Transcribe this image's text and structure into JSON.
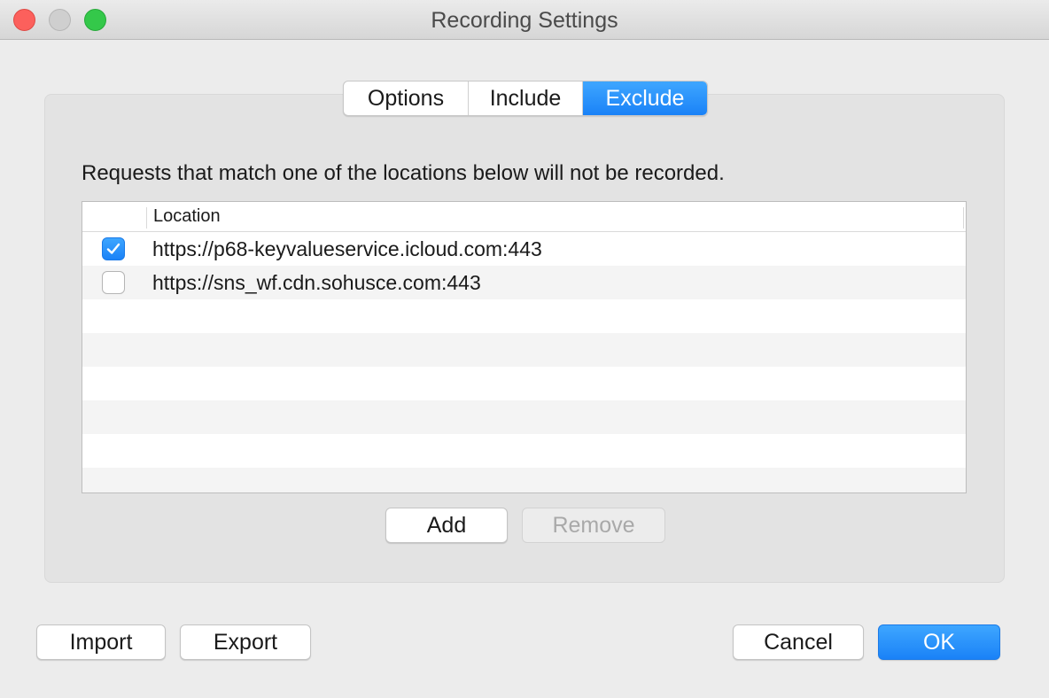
{
  "window": {
    "title": "Recording Settings"
  },
  "tabs": [
    {
      "label": "Options",
      "active": false
    },
    {
      "label": "Include",
      "active": false
    },
    {
      "label": "Exclude",
      "active": true
    }
  ],
  "exclude": {
    "description": "Requests that match one of the locations below will not be recorded.",
    "table": {
      "column_header": "Location",
      "rows": [
        {
          "checked": true,
          "location": "https://p68-keyvalueservice.icloud.com:443"
        },
        {
          "checked": false,
          "location": "https://sns_wf.cdn.sohusce.com:443"
        }
      ]
    },
    "add_label": "Add",
    "remove_label": "Remove"
  },
  "footer": {
    "import_label": "Import",
    "export_label": "Export",
    "cancel_label": "Cancel",
    "ok_label": "OK"
  },
  "colors": {
    "accent": "#1a82f7",
    "close": "#fc605c",
    "minimize": "#cfcfcf",
    "zoom": "#34c84a"
  }
}
